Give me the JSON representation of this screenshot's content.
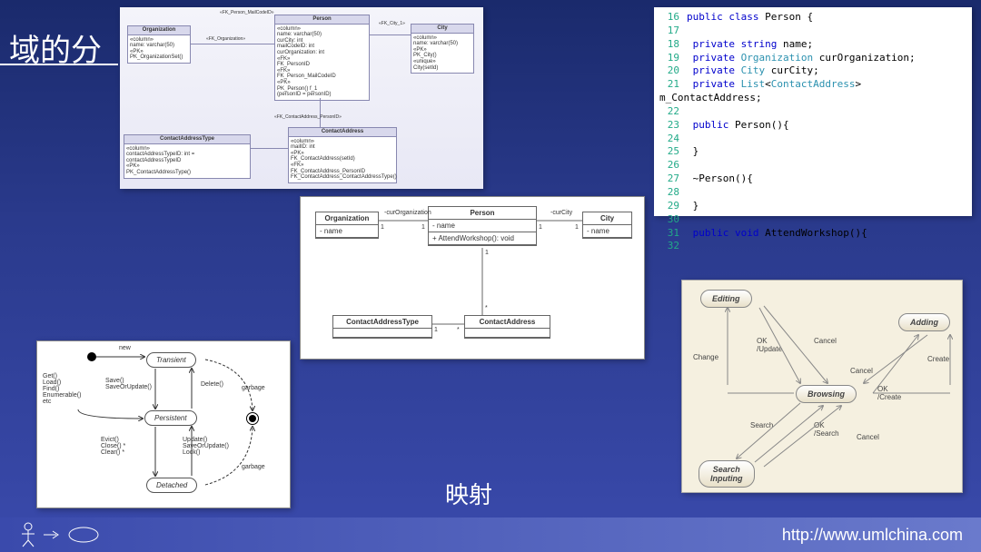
{
  "slide": {
    "title_left": "域的分",
    "title_center": "映射",
    "footer_url": "http://www.umlchina.com"
  },
  "er": {
    "organization": {
      "name": "Organization",
      "cols": "«column»\nname: varchar(50)\n«PK»\nPK_OrganizationSet()"
    },
    "person": {
      "name": "Person",
      "cols": "«column»\nname: varchar(50)\ncurCity: int\nmailCodeID: int\ncurOrganization: int\n«FK»\nFK_PersonID\n«FK»\nFK_Person_MailCodeID\n«PK»\nPK_Person() f_1\n(personID = personID)"
    },
    "city": {
      "name": "City",
      "cols": "«column»\nname: varchar(50)\n«PK»\nPK_City()\n«unique»\nCity(setId)"
    },
    "cat": {
      "name": "ContactAddressType",
      "cols": "«column»\ncontactAddressTypeID: int = contactAddressTypeID\n«PK»\nPK_ContactAddressType()"
    },
    "ca": {
      "name": "ContactAddress",
      "cols": "«column»\nmailID: int\n «PK»\nFK_ContactAddress(setId)\n«FK»\nFK_ContactAddress_PersonID\nFK_ContactAddress_ContactAddressType()"
    },
    "rel1": "«FK_Person_MailCodeID»",
    "rel2": "«FK_Organization»",
    "rel3": "«FK_City_1»",
    "rel4": "«FK_ContactAddress_PersonID»"
  },
  "code": {
    "lines": [
      {
        "n": 16,
        "t": [
          [
            "kw",
            "public"
          ],
          [
            "",
            " "
          ],
          [
            "kw",
            "class"
          ],
          [
            "",
            " Person {"
          ]
        ]
      },
      {
        "n": 17,
        "t": [
          [
            "",
            ""
          ]
        ]
      },
      {
        "n": 18,
        "t": [
          [
            "",
            "    "
          ],
          [
            "kw",
            "private"
          ],
          [
            "",
            " "
          ],
          [
            "kw",
            "string"
          ],
          [
            "",
            " name;"
          ]
        ]
      },
      {
        "n": 19,
        "t": [
          [
            "",
            "    "
          ],
          [
            "kw",
            "private"
          ],
          [
            "",
            " "
          ],
          [
            "tp",
            "Organization"
          ],
          [
            "",
            " curOrganization;"
          ]
        ]
      },
      {
        "n": 20,
        "t": [
          [
            "",
            "    "
          ],
          [
            "kw",
            "private"
          ],
          [
            "",
            " "
          ],
          [
            "tp",
            "City"
          ],
          [
            "",
            " curCity;"
          ]
        ]
      },
      {
        "n": 21,
        "t": [
          [
            "",
            "    "
          ],
          [
            "kw",
            "private"
          ],
          [
            "",
            " "
          ],
          [
            "tp",
            "List"
          ],
          [
            "",
            "<"
          ],
          [
            "tp",
            "ContactAddress"
          ],
          [
            "",
            "> m_ContactAddress;"
          ]
        ]
      },
      {
        "n": 22,
        "t": [
          [
            "",
            ""
          ]
        ]
      },
      {
        "n": 23,
        "t": [
          [
            "",
            "    "
          ],
          [
            "kw",
            "public"
          ],
          [
            "",
            " Person(){"
          ]
        ]
      },
      {
        "n": 24,
        "t": [
          [
            "",
            ""
          ]
        ]
      },
      {
        "n": 25,
        "t": [
          [
            "",
            "    }"
          ]
        ]
      },
      {
        "n": 26,
        "t": [
          [
            "",
            ""
          ]
        ]
      },
      {
        "n": 27,
        "t": [
          [
            "",
            "    ~Person(){"
          ]
        ]
      },
      {
        "n": 28,
        "t": [
          [
            "",
            ""
          ]
        ]
      },
      {
        "n": 29,
        "t": [
          [
            "",
            "    }"
          ]
        ]
      },
      {
        "n": 30,
        "t": [
          [
            "",
            ""
          ]
        ]
      },
      {
        "n": 31,
        "t": [
          [
            "",
            "    "
          ],
          [
            "kw",
            "public"
          ],
          [
            "",
            " "
          ],
          [
            "kw",
            "void"
          ],
          [
            "",
            " AttendWorkshop(){"
          ]
        ]
      },
      {
        "n": 32,
        "t": [
          [
            "",
            ""
          ]
        ]
      }
    ]
  },
  "uml": {
    "organization": {
      "name": "Organization",
      "attr": "-  name"
    },
    "person": {
      "name": "Person",
      "attr": "-  name",
      "op": "+  AttendWorkshop(): void"
    },
    "city": {
      "name": "City",
      "attr": "-  name"
    },
    "cat": {
      "name": "ContactAddressType"
    },
    "ca": {
      "name": "ContactAddress"
    },
    "rel_org": "-curOrganization",
    "rel_city": "-curCity",
    "m1": "1",
    "mstar": "*"
  },
  "state_left": {
    "transient": "Transient",
    "persistent": "Persistent",
    "detached": "Detached",
    "new": "new",
    "get": "Get()\nLoad()\nFind()\nEnumerable()\netc",
    "save": "Save()\nSaveOrUpdate()",
    "delete": "Delete()",
    "evict": "Evict()\nClose() *\nClear() *",
    "update": "Update()\nSaveOrUpdate()\nLock()",
    "garbage1": "garbage",
    "garbage2": "garbage"
  },
  "state_right": {
    "editing": "Editing",
    "adding": "Adding",
    "browsing": "Browsing",
    "search": "Search\nInputing",
    "change": "Change",
    "ok_update": "OK\n/Update",
    "cancel1": "Cancel",
    "cancel2": "Cancel",
    "create": "Create",
    "ok_create": "OK\n/Create",
    "search_lbl": "Search",
    "ok_search": "OK\n/Search",
    "cancel3": "Cancel"
  }
}
